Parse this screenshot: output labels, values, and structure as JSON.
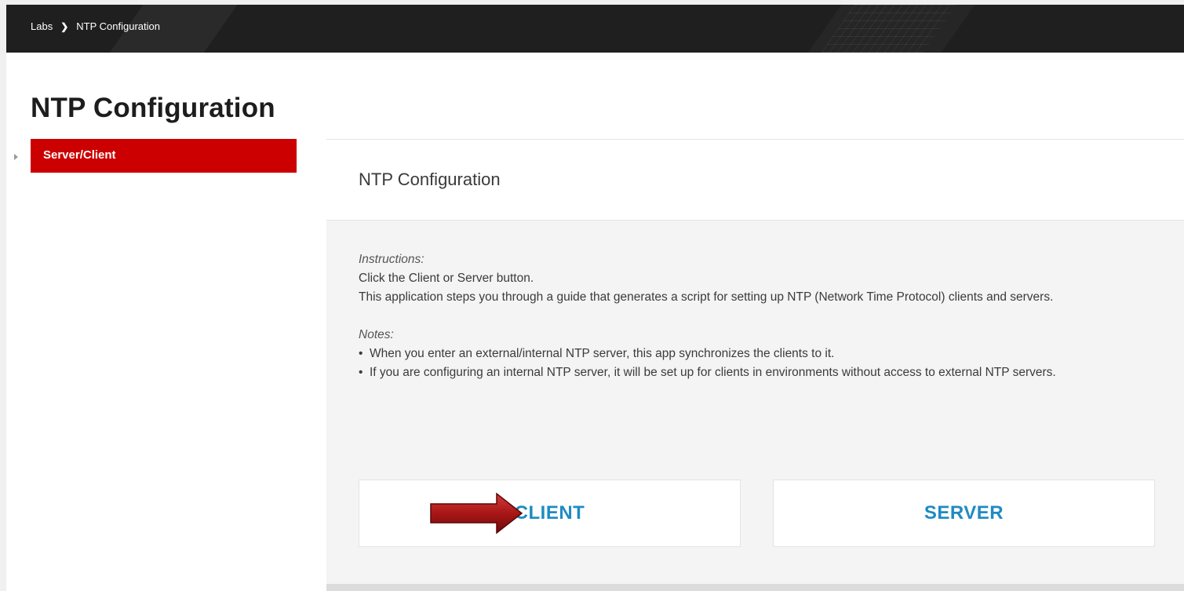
{
  "breadcrumb": {
    "items": [
      "Labs",
      "NTP Configuration"
    ],
    "separator": "❯"
  },
  "page": {
    "title": "NTP Configuration"
  },
  "sidebar": {
    "items": [
      {
        "label": "Server/Client",
        "active": true
      }
    ]
  },
  "panel": {
    "title": "NTP Configuration",
    "instructions_label": "Instructions:",
    "instructions": [
      "Click the Client or Server button.",
      "This application steps you through a guide that generates a script for setting up NTP (Network Time Protocol) clients and servers."
    ],
    "notes_label": "Notes:",
    "notes": [
      "When you enter an external/internal NTP server, this app synchronizes the clients to it.",
      "If you are configuring an internal NTP server, it will be set up for clients in environments without access to external NTP servers."
    ],
    "buttons": {
      "client": "CLIENT",
      "server": "SERVER"
    }
  },
  "colors": {
    "accent_red": "#cc0000",
    "button_text_blue": "#1e8bc3",
    "topbar": "#1f1f1f",
    "annotation_arrow": "#b01c1c"
  },
  "icons": {
    "breadcrumb_separator": "chevron-right-icon",
    "sidebar_expander": "caret-right-icon",
    "annotation": "arrow-right-icon"
  }
}
